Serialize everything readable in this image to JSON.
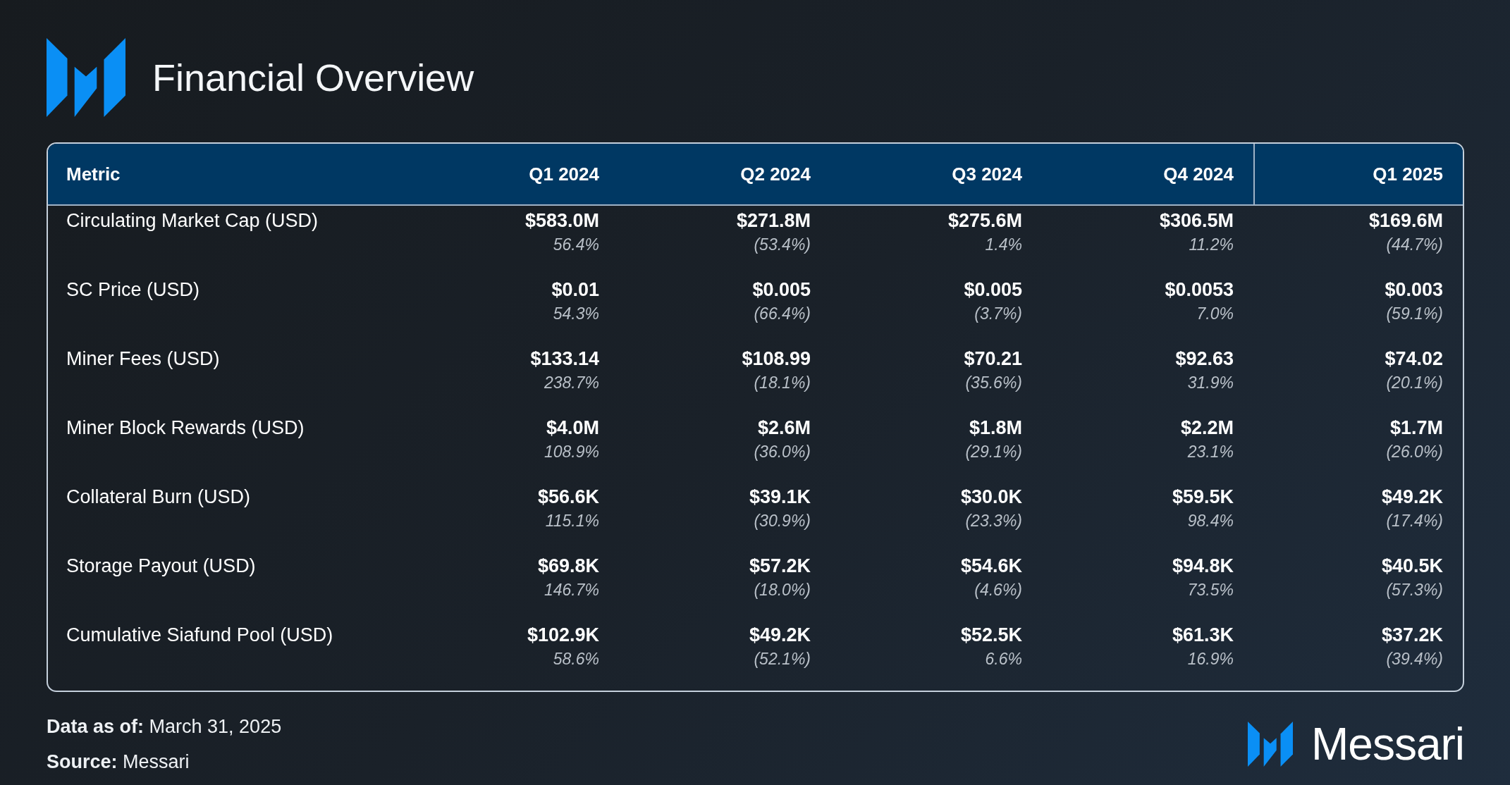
{
  "title": "Financial Overview",
  "table": {
    "columns": [
      "Metric",
      "Q1 2024",
      "Q2 2024",
      "Q3 2024",
      "Q4 2024",
      "Q1 2025"
    ],
    "rows": [
      {
        "cells": [
          {
            "value": "Circulating Market Cap (USD)"
          },
          {
            "value": "$583.0M",
            "change": "56.4%"
          },
          {
            "value": "$271.8M",
            "change": "(53.4%)"
          },
          {
            "value": "$275.6M",
            "change": "1.4%"
          },
          {
            "value": "$306.5M",
            "change": "11.2%"
          },
          {
            "value": "$169.6M",
            "change": "(44.7%)"
          }
        ]
      },
      {
        "cells": [
          {
            "value": "SC Price (USD)"
          },
          {
            "value": "$0.01",
            "change": "54.3%"
          },
          {
            "value": "$0.005",
            "change": "(66.4%)"
          },
          {
            "value": "$0.005",
            "change": "(3.7%)"
          },
          {
            "value": "$0.0053",
            "change": "7.0%"
          },
          {
            "value": "$0.003",
            "change": "(59.1%)"
          }
        ]
      },
      {
        "cells": [
          {
            "value": "Miner Fees (USD)"
          },
          {
            "value": "$133.14",
            "change": "238.7%"
          },
          {
            "value": "$108.99",
            "change": "(18.1%)"
          },
          {
            "value": "$70.21",
            "change": "(35.6%)"
          },
          {
            "value": "$92.63",
            "change": "31.9%"
          },
          {
            "value": "$74.02",
            "change": "(20.1%)"
          }
        ]
      },
      {
        "cells": [
          {
            "value": "Miner Block Rewards (USD)"
          },
          {
            "value": "$4.0M",
            "change": "108.9%"
          },
          {
            "value": "$2.6M",
            "change": "(36.0%)"
          },
          {
            "value": "$1.8M",
            "change": "(29.1%)"
          },
          {
            "value": "$2.2M",
            "change": "23.1%"
          },
          {
            "value": "$1.7M",
            "change": "(26.0%)"
          }
        ]
      },
      {
        "cells": [
          {
            "value": "Collateral Burn (USD)"
          },
          {
            "value": "$56.6K",
            "change": "115.1%"
          },
          {
            "value": "$39.1K",
            "change": "(30.9%)"
          },
          {
            "value": "$30.0K",
            "change": "(23.3%)"
          },
          {
            "value": "$59.5K",
            "change": "98.4%"
          },
          {
            "value": "$49.2K",
            "change": "(17.4%)"
          }
        ]
      },
      {
        "cells": [
          {
            "value": "Storage Payout (USD)"
          },
          {
            "value": "$69.8K",
            "change": "146.7%"
          },
          {
            "value": "$57.2K",
            "change": "(18.0%)"
          },
          {
            "value": "$54.6K",
            "change": "(4.6%)"
          },
          {
            "value": "$94.8K",
            "change": "73.5%"
          },
          {
            "value": "$40.5K",
            "change": "(57.3%)"
          }
        ]
      },
      {
        "cells": [
          {
            "value": "Cumulative Siafund Pool (USD)"
          },
          {
            "value": "$102.9K",
            "change": "58.6%"
          },
          {
            "value": "$49.2K",
            "change": "(52.1%)"
          },
          {
            "value": "$52.5K",
            "change": "6.6%"
          },
          {
            "value": "$61.3K",
            "change": "16.9%"
          },
          {
            "value": "$37.2K",
            "change": "(39.4%)"
          }
        ]
      }
    ]
  },
  "footer": {
    "notes": [
      "**Data as of:** March 31, 2025",
      "**Source:** Messari"
    ],
    "brand": "Messari"
  }
}
